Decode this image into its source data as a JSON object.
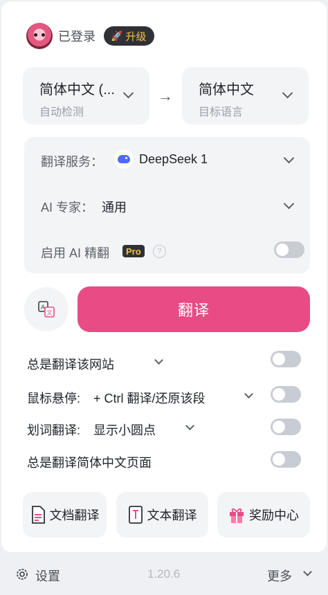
{
  "header": {
    "status": "已登录",
    "upgrade_label": "升级",
    "upgrade_icon": "rocket-icon"
  },
  "languages": {
    "source": {
      "name": "简体中文 (...",
      "sub": "自动检测"
    },
    "target": {
      "name": "简体中文",
      "sub": "目标语言"
    }
  },
  "service": {
    "label": "翻译服务：",
    "value": "DeepSeek 1",
    "expert_label": "AI 专家：",
    "expert_value": "通用",
    "refine_label": "启用 AI 精翻",
    "pro_badge": "Pro",
    "help_glyph": "?",
    "refine_enabled": false
  },
  "translate_button": "翻译",
  "options": [
    {
      "label": "总是翻译该网站",
      "enabled": false
    },
    {
      "label": "鼠标悬停:",
      "value": "+ Ctrl 翻译/还原该段",
      "enabled": false
    },
    {
      "label": "划词翻译:",
      "value": "显示小圆点",
      "enabled": false
    },
    {
      "label": "总是翻译简体中文页面",
      "enabled": false
    }
  ],
  "bottom": {
    "doc": "文档翻译",
    "text": "文本翻译",
    "reward": "奖励中心"
  },
  "footer": {
    "settings": "设置",
    "version": "1.20.6",
    "more": "更多"
  },
  "colors": {
    "accent": "#e94b84",
    "pro_bg": "#2f3136",
    "pro_text": "#f4c542",
    "deepseek": "#4d6bfe"
  }
}
